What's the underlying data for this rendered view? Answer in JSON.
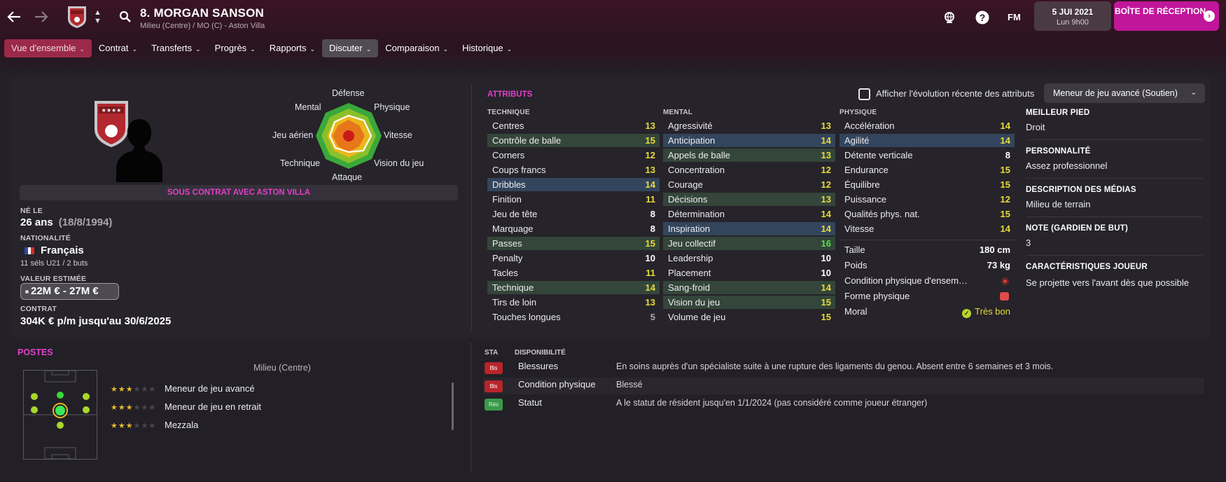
{
  "header": {
    "player_name": "8. MORGAN SANSON",
    "player_sub": "Milieu (Centre) / MO (C) - Aston Villa",
    "fm": "FM",
    "date": "5 JUI 2021",
    "time": "Lun 9h00",
    "inbox": "BOÎTE DE RÉCEPTION",
    "icons": [
      "back-arrow-icon",
      "forward-arrow-icon",
      "club-badge",
      "search-icon",
      "globe-icon",
      "help-icon"
    ]
  },
  "tabs": [
    {
      "label": "Vue d'ensemble",
      "active": true
    },
    {
      "label": "Contrat"
    },
    {
      "label": "Transferts"
    },
    {
      "label": "Progrès"
    },
    {
      "label": "Rapports"
    },
    {
      "label": "Discuter",
      "hover": true
    },
    {
      "label": "Comparaison"
    },
    {
      "label": "Historique"
    }
  ],
  "radar": {
    "labels": [
      "Défense",
      "Physique",
      "Vitesse",
      "Vision du jeu",
      "Attaque",
      "Technique",
      "Jeu aérien",
      "Mental"
    ]
  },
  "profile": {
    "contract_banner": "SOUS CONTRAT AVEC ASTON VILLA",
    "born_label": "NÉ LE",
    "age": "26 ans",
    "birthdate": "(18/8/1994)",
    "nationality_label": "NATIONALITÉ",
    "nationality": "Français",
    "caps": "11 séls U21 / 2 buts",
    "value_label": "VALEUR ESTIMÉE",
    "value": "22M € - 27M €",
    "contract_label": "CONTRAT",
    "contract": "304K € p/m jusqu'au 30/6/2025"
  },
  "attributes": {
    "title": "ATTRIBUTS",
    "toggle_label": "Afficher l'évolution récente des attributs",
    "role_select": "Meneur de jeu avancé (Soutien)",
    "technique": {
      "heading": "TECHNIQUE",
      "rows": [
        {
          "name": "Centres",
          "value": "13"
        },
        {
          "name": "Contrôle de balle",
          "value": "15"
        },
        {
          "name": "Corners",
          "value": "12"
        },
        {
          "name": "Coups francs",
          "value": "13"
        },
        {
          "name": "Dribbles",
          "value": "14"
        },
        {
          "name": "Finition",
          "value": "11"
        },
        {
          "name": "Jeu de tête",
          "value": "8"
        },
        {
          "name": "Marquage",
          "value": "8"
        },
        {
          "name": "Passes",
          "value": "15"
        },
        {
          "name": "Penalty",
          "value": "10"
        },
        {
          "name": "Tacles",
          "value": "11"
        },
        {
          "name": "Technique",
          "value": "14"
        },
        {
          "name": "Tirs de loin",
          "value": "13"
        },
        {
          "name": "Touches longues",
          "value": "5"
        }
      ]
    },
    "mental": {
      "heading": "MENTAL",
      "rows": [
        {
          "name": "Agressivité",
          "value": "13"
        },
        {
          "name": "Anticipation",
          "value": "14"
        },
        {
          "name": "Appels de balle",
          "value": "13"
        },
        {
          "name": "Concentration",
          "value": "12"
        },
        {
          "name": "Courage",
          "value": "12"
        },
        {
          "name": "Décisions",
          "value": "13"
        },
        {
          "name": "Détermination",
          "value": "14"
        },
        {
          "name": "Inspiration",
          "value": "14"
        },
        {
          "name": "Jeu collectif",
          "value": "16"
        },
        {
          "name": "Leadership",
          "value": "10"
        },
        {
          "name": "Placement",
          "value": "10"
        },
        {
          "name": "Sang-froid",
          "value": "14"
        },
        {
          "name": "Vision du jeu",
          "value": "15"
        },
        {
          "name": "Volume de jeu",
          "value": "15"
        }
      ]
    },
    "physique": {
      "heading": "PHYSIQUE",
      "rows": [
        {
          "name": "Accélération",
          "value": "14"
        },
        {
          "name": "Agilité",
          "value": "14"
        },
        {
          "name": "Détente verticale",
          "value": "8"
        },
        {
          "name": "Endurance",
          "value": "15"
        },
        {
          "name": "Équilibre",
          "value": "15"
        },
        {
          "name": "Puissance",
          "value": "12"
        },
        {
          "name": "Qualités phys. nat.",
          "value": "15"
        },
        {
          "name": "Vitesse",
          "value": "14"
        }
      ]
    },
    "misc": {
      "height_label": "Taille",
      "height": "180 cm",
      "weight_label": "Poids",
      "weight": "73 kg",
      "condition_label": "Condition physique d'ensem…",
      "form_label": "Forme physique",
      "morale_label": "Moral",
      "morale": "Très bon"
    }
  },
  "info": {
    "foot_label": "MEILLEUR PIED",
    "foot": "Droit",
    "personality_label": "PERSONNALITÉ",
    "personality": "Assez professionnel",
    "media_label": "DESCRIPTION DES MÉDIAS",
    "media": "Milieu de terrain",
    "gk_label": "NOTE (GARDIEN DE BUT)",
    "gk": "3",
    "traits_label": "CARACTÉRISTIQUES JOUEUR",
    "traits": "Se projette vers l'avant dès que possible"
  },
  "positions": {
    "title": "POSTES",
    "position_name": "Milieu (Centre)",
    "roles": [
      {
        "name": "Meneur de jeu avancé",
        "stars": 3
      },
      {
        "name": "Meneur de jeu en retrait",
        "stars": 3
      },
      {
        "name": "Mezzala",
        "stars": 3
      }
    ]
  },
  "status": {
    "col_sta": "STA",
    "col_dispo": "DISPONIBILITÉ",
    "rows": [
      {
        "badge": "Bls",
        "type": "Blessures",
        "desc": "En soins auprès d'un spécialiste suite à une rupture des ligaments du genou. Absent entre 6 semaines et 3 mois."
      },
      {
        "badge": "Bls",
        "type": "Condition physique",
        "desc": "Blessé"
      },
      {
        "badge": "Rés",
        "type": "Statut",
        "desc": "A le statut de résident jusqu'en 1/1/2024 (pas considéré comme joueur étranger)"
      }
    ]
  }
}
